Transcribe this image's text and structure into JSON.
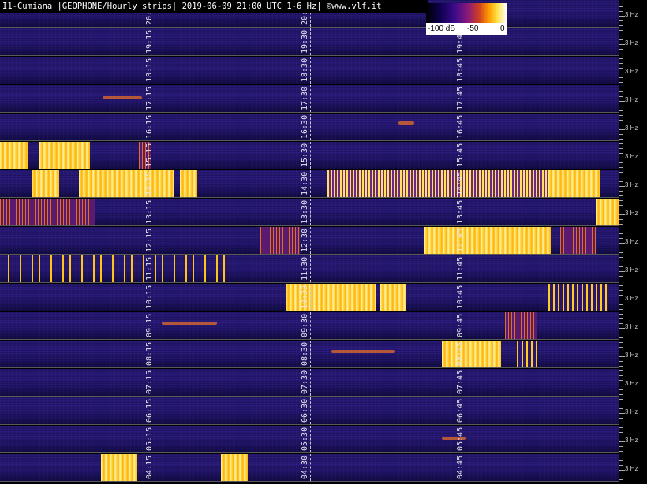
{
  "title": "I1-Cumiana |GEOPHONE/Hourly strips| 2019-06-09 21:00 UTC 1-6 Hz| ©www.vlf.it",
  "legend": {
    "left_label": "-100 dB",
    "mid_label": "-50",
    "right_label": "0"
  },
  "axis_label": "3 Hz",
  "strips": [
    {
      "labels": [
        "20:",
        "20:",
        ""
      ]
    },
    {
      "labels": [
        "19:15",
        "19:30",
        "19:45"
      ]
    },
    {
      "labels": [
        "18:15",
        "18:30",
        "18:45"
      ]
    },
    {
      "labels": [
        "17:15",
        "17:30",
        "17:45"
      ]
    },
    {
      "labels": [
        "16:15",
        "16:30",
        "16:45"
      ]
    },
    {
      "labels": [
        "15:15",
        "15:30",
        "15:45"
      ]
    },
    {
      "labels": [
        "14:15",
        "14:30",
        "14:45"
      ]
    },
    {
      "labels": [
        "13:15",
        "13:30",
        "13:45"
      ]
    },
    {
      "labels": [
        "12:15",
        "12:30",
        "12:45"
      ]
    },
    {
      "labels": [
        "11:15",
        "11:30",
        "11:45"
      ]
    },
    {
      "labels": [
        "10:15",
        "10:30",
        "10:45"
      ]
    },
    {
      "labels": [
        "09:15",
        "09:30",
        "09:45"
      ]
    },
    {
      "labels": [
        "08:15",
        "08:30",
        "08:45"
      ]
    },
    {
      "labels": [
        "07:15",
        "07:30",
        "07:45"
      ]
    },
    {
      "labels": [
        "06:15",
        "06:30",
        "06:45"
      ]
    },
    {
      "labels": [
        "05:15",
        "05:30",
        "05:45"
      ]
    },
    {
      "labels": [
        "04:15",
        "04:30",
        "04:45"
      ]
    }
  ]
}
